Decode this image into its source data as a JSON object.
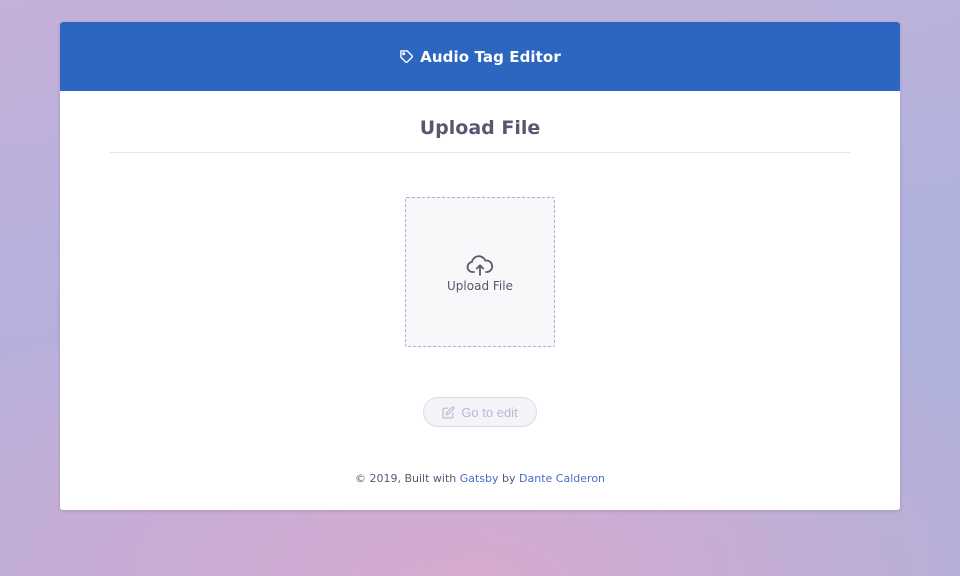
{
  "header": {
    "title": "Audio Tag Editor",
    "icon": "tag-icon"
  },
  "main": {
    "section_title": "Upload File",
    "dropzone": {
      "label": "Upload File",
      "icon": "cloud-upload-icon"
    },
    "edit_button": {
      "label": "Go to edit",
      "icon": "edit-icon",
      "disabled": true
    }
  },
  "footer": {
    "prefix": "© 2019, Built with",
    "gatsby_link": "Gatsby",
    "by_text": "by",
    "author_link": "Dante Calderon"
  },
  "colors": {
    "header_bg": "#2c66c1",
    "card_bg": "#ffffff",
    "title_text": "#595770",
    "link": "#4a6cc9",
    "dropzone_border": "#b7a8cf",
    "disabled_button_text": "#c5b2d6"
  }
}
